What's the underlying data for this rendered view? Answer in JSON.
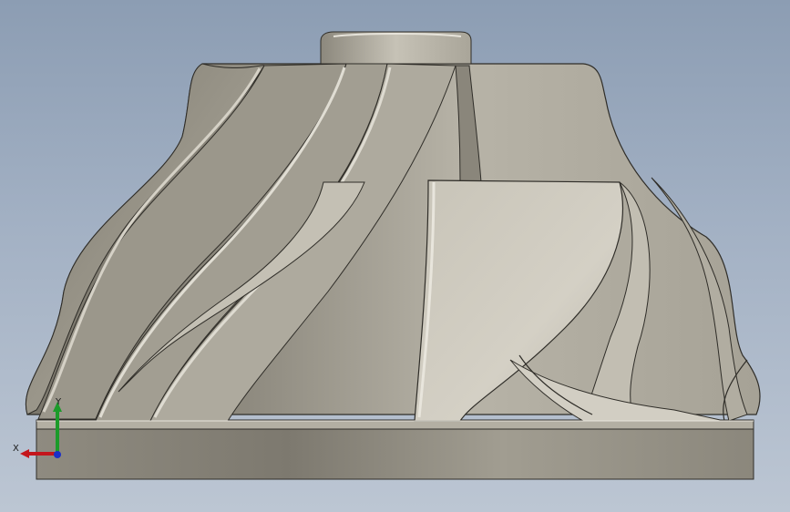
{
  "viewport": {
    "background_top": "#8c9db3",
    "background_bottom": "#bcc6d3"
  },
  "model": {
    "part": "impeller",
    "base_color": "#a8a497",
    "face_light": "#cfcbc0",
    "face_dark": "#858174",
    "edge_color": "#2f2d28"
  },
  "triad": {
    "x_label": "X",
    "y_label": "Y",
    "x_color": "#c4161c",
    "y_color": "#1c9b2a",
    "z_color": "#1b2fc9"
  }
}
